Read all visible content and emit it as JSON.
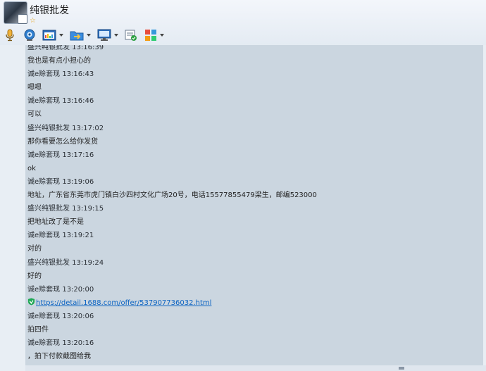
{
  "window": {
    "title": "纯银批发",
    "star": "☆"
  },
  "toolbar": {
    "buttons": [
      {
        "name": "voice",
        "icon": "microphone-icon",
        "has_menu": false
      },
      {
        "name": "video",
        "icon": "camera-icon",
        "has_menu": false
      },
      {
        "name": "image",
        "icon": "picture-icon",
        "has_menu": true
      },
      {
        "name": "file",
        "icon": "folder-transfer-icon",
        "has_menu": true
      },
      {
        "name": "screen",
        "icon": "monitor-icon",
        "has_menu": true
      },
      {
        "name": "history",
        "icon": "chat-record-icon",
        "has_menu": false
      },
      {
        "name": "apps",
        "icon": "app-grid-icon",
        "has_menu": true
      }
    ]
  },
  "messages": [
    {
      "type": "meta",
      "text": "盛兴纯银批发 13:16:39"
    },
    {
      "type": "body",
      "text": "我也是有点小担心的"
    },
    {
      "type": "meta",
      "text": "诚e赊套现 13:16:43"
    },
    {
      "type": "body",
      "text": "嗯嗯"
    },
    {
      "type": "meta",
      "text": "诚e赊套现 13:16:46"
    },
    {
      "type": "body",
      "text": "可以"
    },
    {
      "type": "meta",
      "text": "盛兴纯银批发 13:17:02"
    },
    {
      "type": "body",
      "text": "那你看要怎么给你发货"
    },
    {
      "type": "meta",
      "text": "诚e赊套现 13:17:16"
    },
    {
      "type": "body",
      "text": "ok"
    },
    {
      "type": "meta",
      "text": "诚e赊套现 13:19:06"
    },
    {
      "type": "body",
      "text": "地址，广东省东莞市虎门镇白沙四村文化广场20号，电话15577855479梁生，邮编523000"
    },
    {
      "type": "meta",
      "text": "盛兴纯银批发 13:19:15"
    },
    {
      "type": "body",
      "text": "把地址改了是不是"
    },
    {
      "type": "meta",
      "text": "诚e赊套现 13:19:21"
    },
    {
      "type": "body",
      "text": "对的"
    },
    {
      "type": "meta",
      "text": "盛兴纯银批发 13:19:24"
    },
    {
      "type": "body",
      "text": "好的"
    },
    {
      "type": "meta",
      "text": "诚e赊套现 13:20:00"
    },
    {
      "type": "link",
      "text": "https://detail.1688.com/offer/537907736032.html"
    },
    {
      "type": "meta",
      "text": "诚e赊套现 13:20:06"
    },
    {
      "type": "body",
      "text": "拍四件"
    },
    {
      "type": "meta",
      "text": "诚e赊套现 13:20:16"
    },
    {
      "type": "body",
      "text": "，拍下付款截图给我"
    }
  ],
  "colors": {
    "chat_bg": "#cbd6e0",
    "link": "#0b63c2",
    "star": "#e6a417"
  }
}
